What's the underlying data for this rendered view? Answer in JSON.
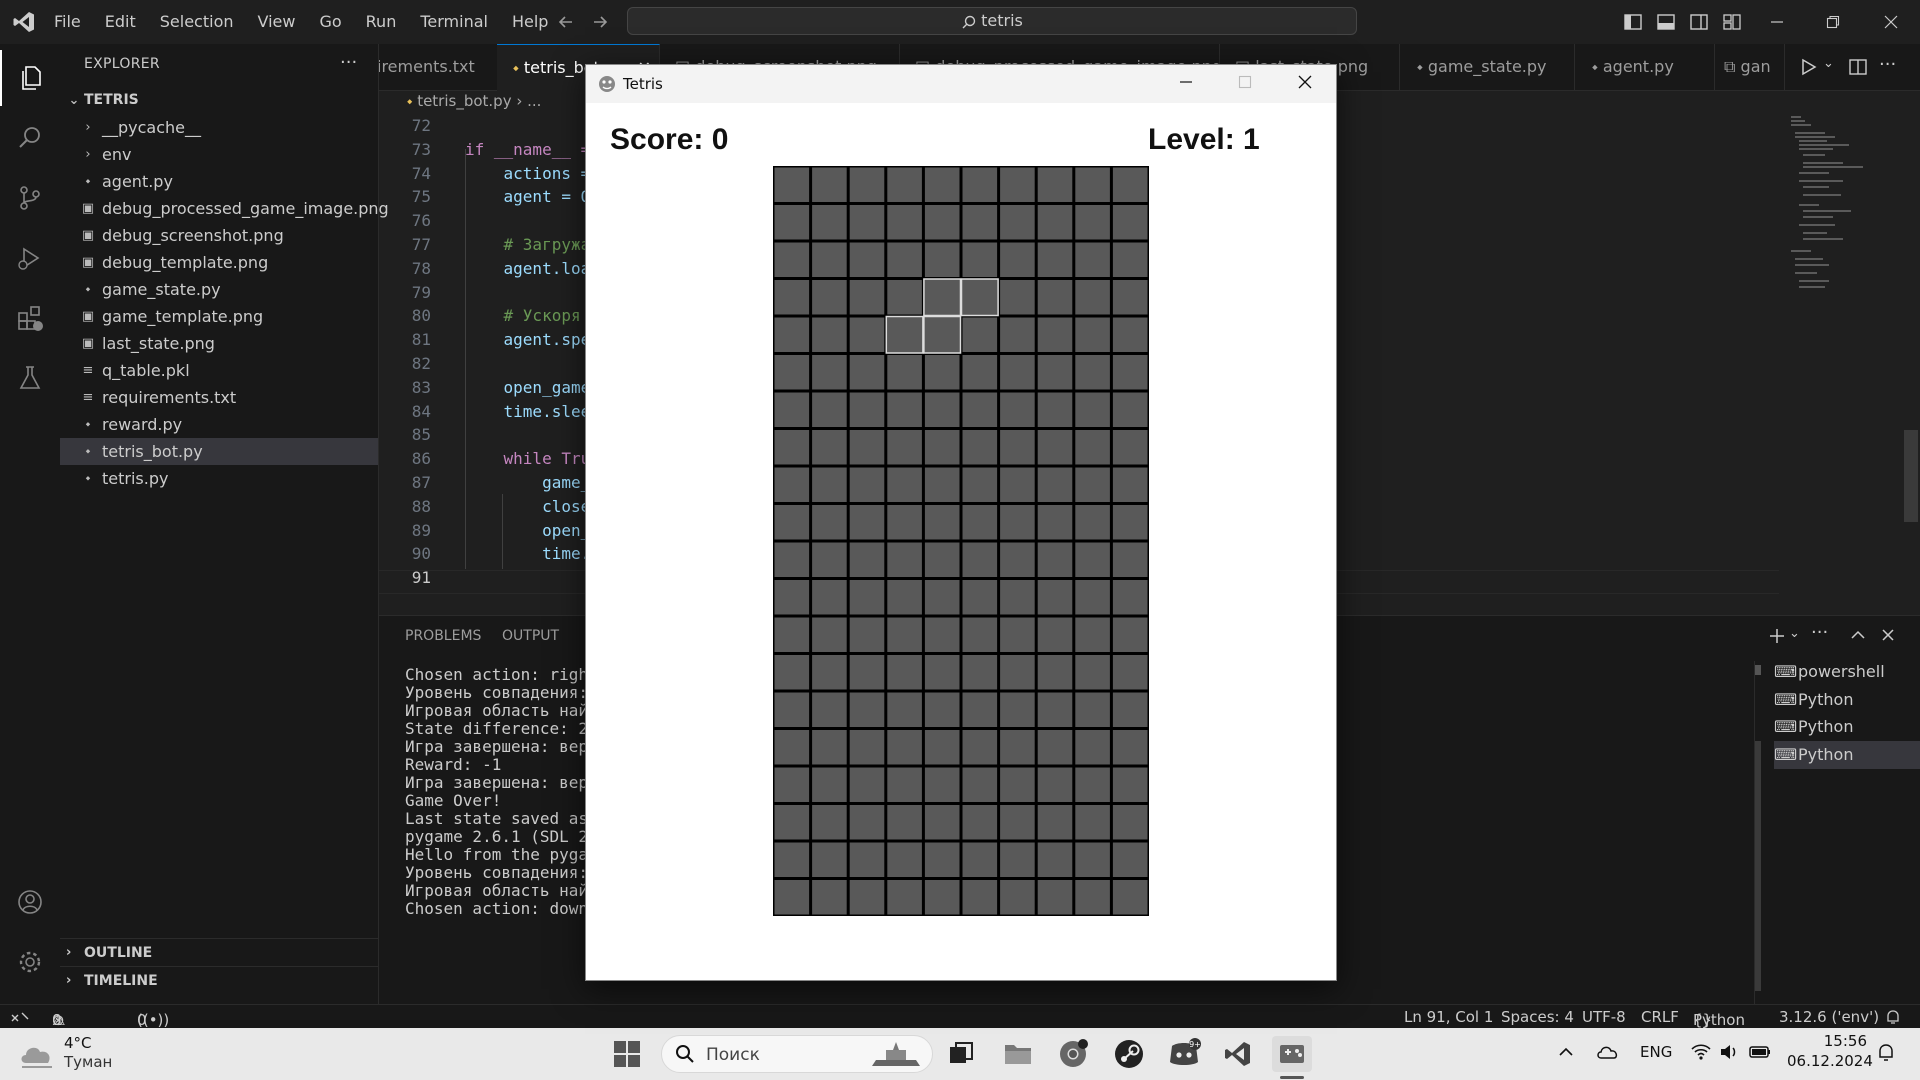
{
  "titlebar": {
    "menu": [
      "File",
      "Edit",
      "Selection",
      "View",
      "Go",
      "Run",
      "Terminal",
      "Help"
    ],
    "search": "tetris"
  },
  "sidebar": {
    "title": "EXPLORER",
    "folder": "TETRIS",
    "items": [
      {
        "label": "__pycache__",
        "kind": "folder"
      },
      {
        "label": "env",
        "kind": "folder"
      },
      {
        "label": "agent.py",
        "kind": "python"
      },
      {
        "label": "debug_processed_game_image.png",
        "kind": "image"
      },
      {
        "label": "debug_screenshot.png",
        "kind": "image"
      },
      {
        "label": "debug_template.png",
        "kind": "image"
      },
      {
        "label": "game_state.py",
        "kind": "python"
      },
      {
        "label": "game_template.png",
        "kind": "image"
      },
      {
        "label": "last_state.png",
        "kind": "image"
      },
      {
        "label": "q_table.pkl",
        "kind": "file"
      },
      {
        "label": "requirements.txt",
        "kind": "file"
      },
      {
        "label": "reward.py",
        "kind": "python"
      },
      {
        "label": "tetris_bot.py",
        "kind": "python",
        "selected": true
      },
      {
        "label": "tetris.py",
        "kind": "python"
      }
    ],
    "outline": "OUTLINE",
    "timeline": "TIMELINE"
  },
  "editor": {
    "tabs": [
      {
        "label": "irements.txt",
        "active": false
      },
      {
        "label": "tetris_bot.py",
        "active": true
      },
      {
        "label": "debug_screenshot.png",
        "active": false
      },
      {
        "label": "debug_processed_game_image.png",
        "active": false
      },
      {
        "label": "last_state.png",
        "active": false
      },
      {
        "label": "game_state.py",
        "active": false
      },
      {
        "label": "agent.py",
        "active": false
      },
      {
        "label": "gan",
        "active": false
      }
    ],
    "breadcrumb": [
      "tetris_bot.py",
      "..."
    ],
    "current_line": "91",
    "lines": [
      {
        "n": "72",
        "text": ""
      },
      {
        "n": "73",
        "text": "if __name__ =="
      },
      {
        "n": "74",
        "text": "    actions ="
      },
      {
        "n": "75",
        "text": "    agent = Q"
      },
      {
        "n": "76",
        "text": ""
      },
      {
        "n": "77",
        "text": "    # Загружа"
      },
      {
        "n": "78",
        "text": "    agent.loa"
      },
      {
        "n": "79",
        "text": ""
      },
      {
        "n": "80",
        "text": "    # Ускоря"
      },
      {
        "n": "81",
        "text": "    agent.spe"
      },
      {
        "n": "82",
        "text": ""
      },
      {
        "n": "83",
        "text": "    open_game"
      },
      {
        "n": "84",
        "text": "    time.slee"
      },
      {
        "n": "85",
        "text": ""
      },
      {
        "n": "86",
        "text": "    while Tru"
      },
      {
        "n": "87",
        "text": "        game_"
      },
      {
        "n": "88",
        "text": "        close"
      },
      {
        "n": "89",
        "text": "        open_"
      },
      {
        "n": "90",
        "text": "        time."
      },
      {
        "n": "91",
        "text": ""
      }
    ]
  },
  "panel": {
    "tabs": [
      "PROBLEMS",
      "OUTPUT"
    ],
    "terminal_lines": [
      "Chosen action: right",
      "Уровень совпадения:",
      "Игровая область найд",
      "State difference: 2",
      "Игра завершена: верх",
      "Reward: -1",
      "Игра завершена: верх",
      "Game Over!",
      "Last state saved as",
      "pygame 2.6.1 (SDL 2.",
      "Hello from the pygam",
      "Уровень совпадения:",
      "Игровая область найд",
      "Chosen action: down"
    ],
    "terminals": [
      {
        "label": "powershell",
        "selected": false
      },
      {
        "label": "Python",
        "selected": false
      },
      {
        "label": "Python",
        "selected": false
      },
      {
        "label": "Python",
        "selected": true
      }
    ]
  },
  "statusbar": {
    "errors": "0",
    "warnings": "0",
    "ports": "0",
    "position": "Ln 91, Col 1",
    "spaces": "Spaces: 4",
    "encoding": "UTF-8",
    "eol": "CRLF",
    "language": "Python",
    "interpreter": "3.12.6 ('env')"
  },
  "tetris": {
    "title": "Tetris",
    "score": "Score: 0",
    "level": "Level: 1",
    "grid_cols": 10,
    "grid_rows": 20,
    "active_piece": [
      [
        3,
        4
      ],
      [
        3,
        5
      ],
      [
        4,
        3
      ],
      [
        4,
        4
      ]
    ],
    "cell_color": "#595959",
    "line_color": "#000000",
    "piece_outline": "#dddddd"
  },
  "taskbar": {
    "temperature": "4°C",
    "weather": "Туман",
    "search_placeholder": "Поиск",
    "lang": "ENG",
    "time": "15:56",
    "date": "06.12.2024"
  },
  "colors": {
    "accent": "#0078d4",
    "editor_bg": "#1f1f1f",
    "sidebar_bg": "#181818"
  }
}
